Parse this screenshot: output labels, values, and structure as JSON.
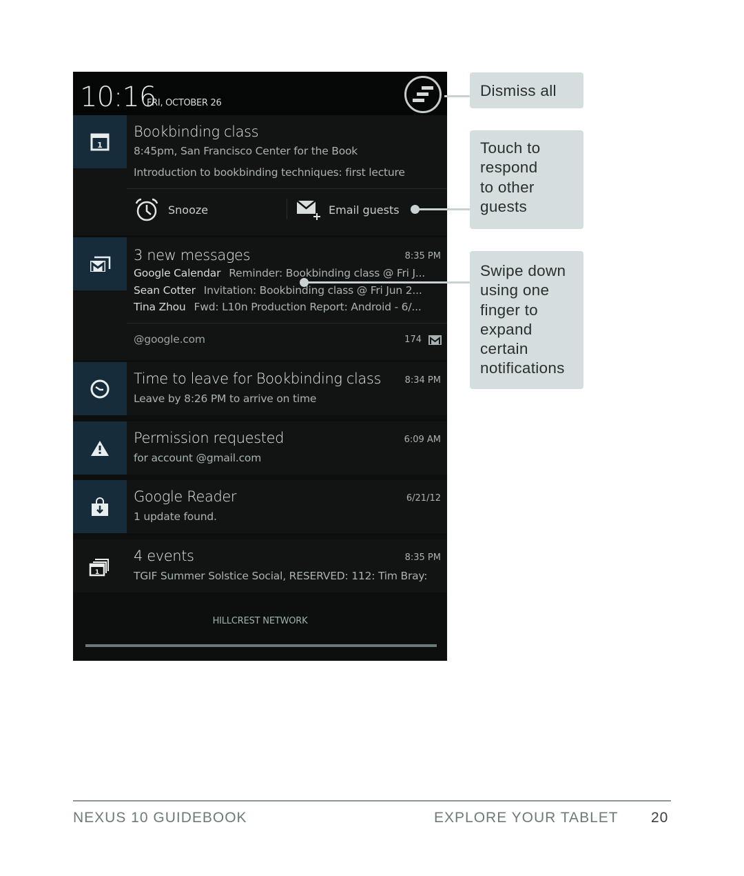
{
  "status_bar": {
    "time": "10:16",
    "date": "FRI, OCTOBER 26"
  },
  "notifications": [
    {
      "icon": "calendar-icon",
      "title": "Bookbinding class",
      "line1": "8:45pm, San Francisco Center for the Book",
      "line2": "Introduction to bookbinding techniques: first lecture",
      "actions": [
        {
          "icon": "alarm-clock-icon",
          "label": "Snooze"
        },
        {
          "icon": "email-add-icon",
          "label": "Email guests"
        }
      ]
    },
    {
      "icon": "gmail-stack-icon",
      "title": "3 new messages",
      "time": "8:35 PM",
      "messages": [
        {
          "sender": "Google Calendar",
          "text": "Reminder: Bookbinding class @ Fri J..."
        },
        {
          "sender": "Sean Cotter",
          "text": "Invitation: Bookbinding class @ Fri Jun 2..."
        },
        {
          "sender": "Tina Zhou",
          "text": "Fwd: L10n Production Report: Android - 6/..."
        }
      ],
      "account": "@google.com",
      "unread_count": "174"
    },
    {
      "icon": "clock-icon",
      "title": "Time to leave for Bookbinding class",
      "subtitle": "Leave by 8:26 PM to arrive on time",
      "time": "8:34 PM"
    },
    {
      "icon": "warning-icon",
      "title": "Permission requested",
      "subtitle": "for account @gmail.com",
      "time": "6:09 AM"
    },
    {
      "icon": "play-store-download-icon",
      "title": "Google Reader",
      "subtitle": "1 update found.",
      "time": "6/21/12"
    },
    {
      "icon": "calendar-stack-icon",
      "title": "4 events",
      "subtitle": "TGIF Summer Solstice Social, RESERVED: 112: Tim Bray:",
      "time": "8:35 PM"
    }
  ],
  "carrier": "HILLCREST NETWORK",
  "callouts": {
    "dismiss_all": "Dismiss all",
    "touch_respond": [
      "Touch to",
      "respond",
      "to other",
      "guests"
    ],
    "swipe_down": [
      "Swipe down",
      "using one",
      "finger to",
      "expand",
      "certain",
      "notifications"
    ]
  },
  "footer": {
    "book_title": "NEXUS 10 GUIDEBOOK",
    "section": "EXPLORE YOUR TABLET",
    "page_number": "20"
  },
  "colors": {
    "icon_tile": "#162c3a",
    "panel_bg": "#121414",
    "callout_bg": "#d5dede",
    "footer_text": "#6c7a7a"
  }
}
